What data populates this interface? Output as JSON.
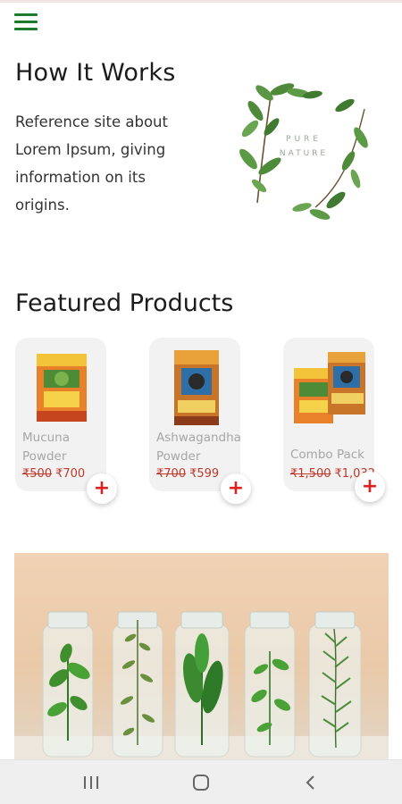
{
  "header": {
    "menu_icon": "hamburger-menu-icon",
    "accent_color": "#1f7a2e"
  },
  "how_it_works": {
    "title": "How It Works",
    "description": "Reference site about Lorem Ipsum, giving information on its origins."
  },
  "logo": {
    "line1": "PURE",
    "line2": "NATURE"
  },
  "featured": {
    "title": "Featured Products",
    "products": [
      {
        "name_line1": "Mucuna",
        "name_line2": "Powder",
        "old_price": "₹500",
        "new_price": "₹700"
      },
      {
        "name_line1": "Ashwagandha",
        "name_line2": "Powder",
        "old_price": "₹700",
        "new_price": "₹599"
      },
      {
        "name_line1": "Combo Pack",
        "name_line2": "",
        "old_price": "₹1,500",
        "new_price": "₹1,032"
      }
    ],
    "add_icon": "plus-icon",
    "price_color": "#c0392b"
  },
  "banner": {
    "image": "herb-jars-photo"
  },
  "system_nav": {
    "recents_icon": "recents-icon",
    "home_icon": "home-icon",
    "back_icon": "back-icon"
  }
}
